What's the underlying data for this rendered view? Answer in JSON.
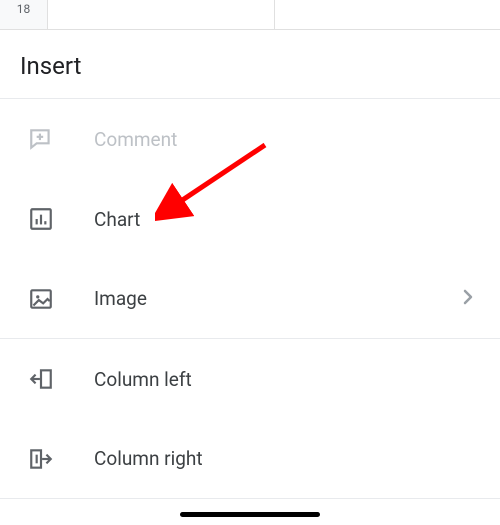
{
  "sheet": {
    "visible_row": "18"
  },
  "panel": {
    "title": "Insert"
  },
  "items": {
    "comment": {
      "label": "Comment"
    },
    "chart": {
      "label": "Chart"
    },
    "image": {
      "label": "Image"
    },
    "column_left": {
      "label": "Column left"
    },
    "column_right": {
      "label": "Column right"
    }
  },
  "annotation": {
    "arrow_color": "#ff0000"
  }
}
